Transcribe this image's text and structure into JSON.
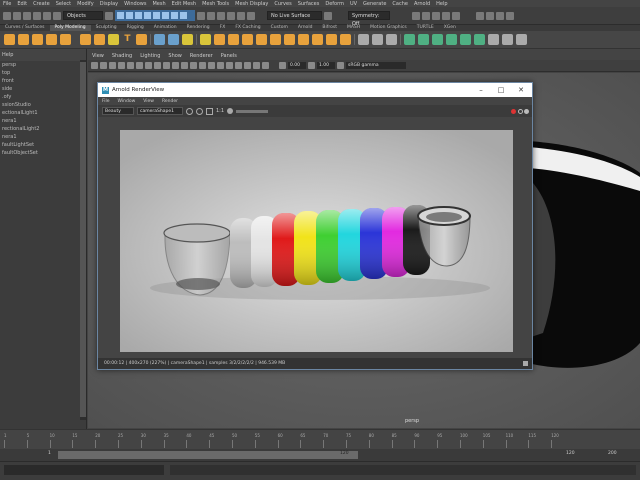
{
  "menubar": [
    "File",
    "Edit",
    "Create",
    "Select",
    "Modify",
    "Display",
    "Windows",
    "Mesh",
    "Edit Mesh",
    "Mesh Tools",
    "Mesh Display",
    "Curves",
    "Surfaces",
    "Deform",
    "UV",
    "Generate",
    "Cache",
    "Arnold",
    "Help"
  ],
  "statusline": {
    "select_mode": "Objects",
    "live_surface": "No Live Surface",
    "symmetry": "Symmetry: Off"
  },
  "shelf_tabs": [
    "Curves / Surfaces",
    "Poly Modeling",
    "Sculpting",
    "Rigging",
    "Animation",
    "Rendering",
    "FX",
    "FX Caching",
    "Custom",
    "Arnold",
    "Bifrost",
    "MASH",
    "Motion Graphics",
    "TURTLE",
    "XGen"
  ],
  "shelf_active": "Poly Modeling",
  "outliner": {
    "help": "Help",
    "items": [
      "persp",
      "top",
      "front",
      "side",
      ".ofy",
      "ssionStudio",
      "ectionalLight1",
      "nera1",
      "rectionalLight2",
      "nera1",
      "faultLightSet",
      "faultObjectSet"
    ]
  },
  "viewport_menu": [
    "View",
    "Shading",
    "Lighting",
    "Show",
    "Renderer",
    "Panels"
  ],
  "viewport_tool": {
    "exposure": "0.00",
    "gamma": "1.00",
    "colorspace": "sRGB gamma"
  },
  "camera_label": "persp",
  "timeline": {
    "ticks": [
      "1",
      "5",
      "10",
      "15",
      "20",
      "25",
      "30",
      "35",
      "40",
      "45",
      "50",
      "55",
      "60",
      "65",
      "70",
      "75",
      "80",
      "85",
      "90",
      "95",
      "100",
      "105",
      "110",
      "115",
      "120"
    ]
  },
  "range": {
    "start": "1",
    "end": "120",
    "end2": "120",
    "max": "200"
  },
  "renderview": {
    "title": "Arnold RenderView",
    "menu": [
      "File",
      "Window",
      "View",
      "Render"
    ],
    "aov": "Beauty",
    "camera": "cameraShape1",
    "ratio": "1:1",
    "status": "00:00:12 | 400x270 (227%) | cameraShape1 | samples 3/2/2/2/2/2 | 946.539 MB"
  },
  "colors": {
    "accent_blue": "#3d6b9a",
    "shelf_active": "#565656",
    "title_bg": "#ffffff"
  }
}
